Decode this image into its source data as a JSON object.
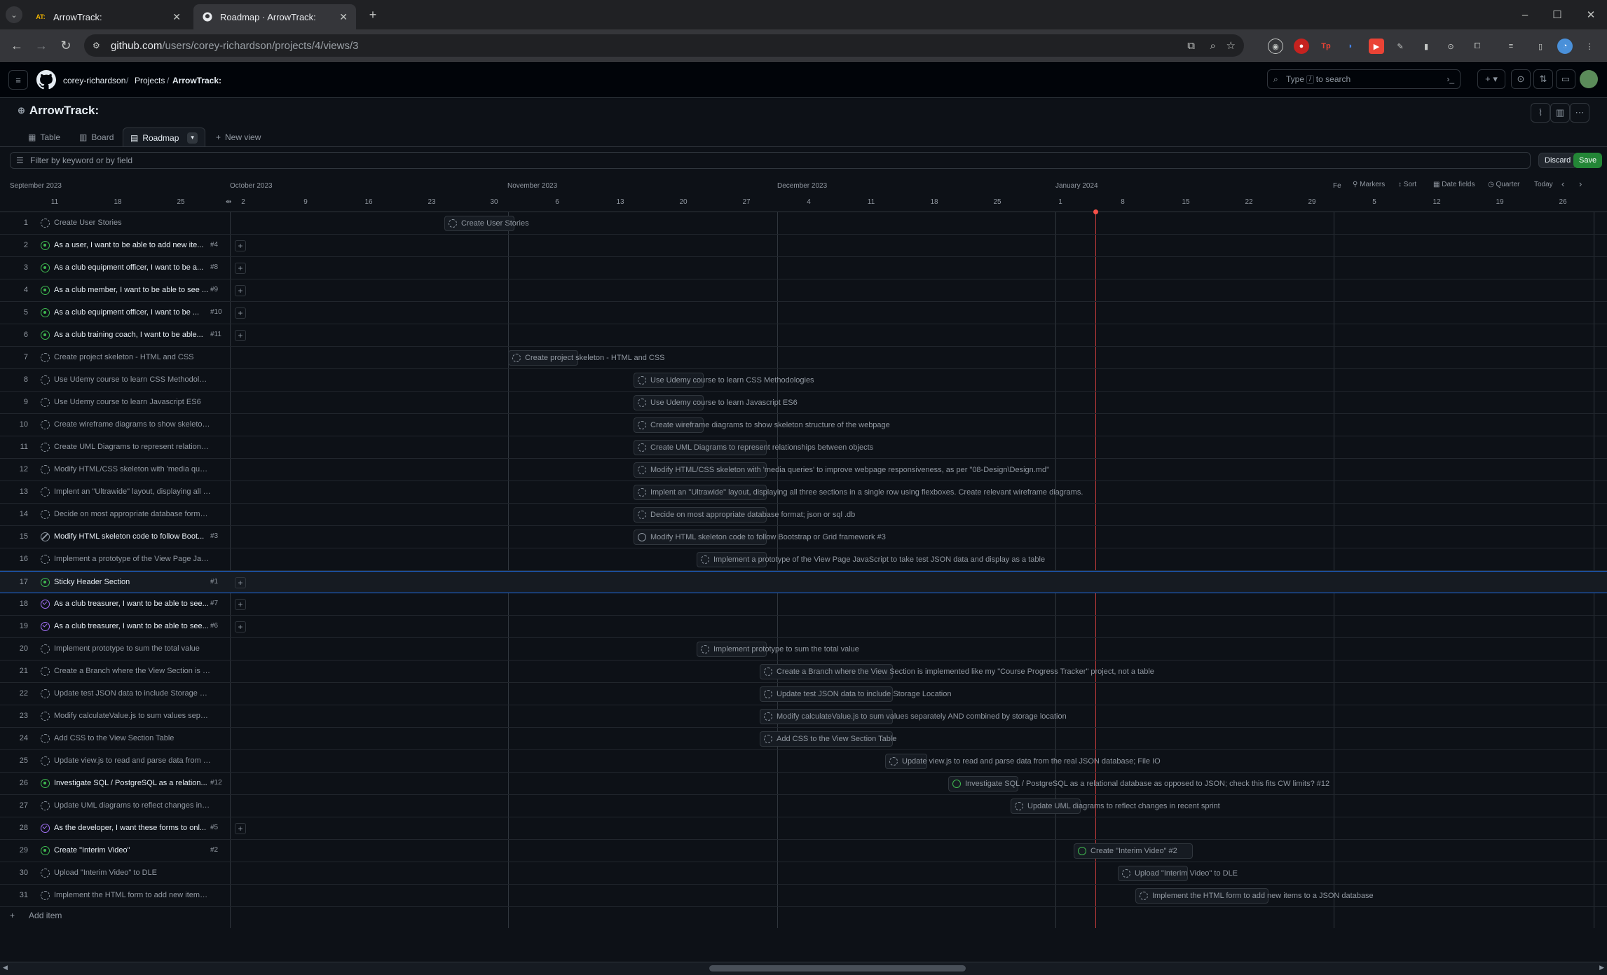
{
  "browser": {
    "tabs": [
      {
        "icon_text": "AT:",
        "title": "ArrowTrack:"
      },
      {
        "icon_text": "",
        "title": "Roadmap · ArrowTrack:"
      }
    ],
    "url_host": "github.com",
    "url_path": "/users/corey-richardson/projects/4/views/3"
  },
  "header": {
    "breadcrumb": [
      "corey-richardson",
      "/",
      "Projects",
      "/",
      "ArrowTrack:"
    ],
    "search_placeholder_prefix": "Type",
    "search_key": "/",
    "search_placeholder_suffix": "to search"
  },
  "project": {
    "title": "ArrowTrack:",
    "views": [
      "Table",
      "Board",
      "Roadmap"
    ],
    "new_view": "New view",
    "filter_placeholder": "Filter by keyword or by field",
    "discard": "Discard",
    "save": "Save"
  },
  "timeline": {
    "months": [
      "September 2023",
      "October 2023",
      "November 2023",
      "December 2023",
      "January 2024",
      "Fe"
    ],
    "days": [
      "11",
      "18",
      "25",
      "2",
      "9",
      "16",
      "23",
      "30",
      "6",
      "13",
      "20",
      "27",
      "4",
      "11",
      "18",
      "25",
      "1",
      "8",
      "15",
      "22",
      "29",
      "5",
      "12",
      "19",
      "26"
    ],
    "controls": {
      "markers": "Markers",
      "sort": "Sort",
      "date_fields": "Date fields",
      "zoom": "Quarter",
      "today": "Today"
    }
  },
  "rows": [
    {
      "n": "1",
      "title": "Create User Stories",
      "ref": "",
      "state": "draft",
      "issue": false,
      "plus": false,
      "bar": "Create User Stories"
    },
    {
      "n": "2",
      "title": "As a user, I want to be able to add new ite...",
      "ref": "#4",
      "state": "open",
      "issue": true,
      "plus": true,
      "bar": ""
    },
    {
      "n": "3",
      "title": "As a club equipment officer, I want to be a...",
      "ref": "#8",
      "state": "open",
      "issue": true,
      "plus": true,
      "bar": ""
    },
    {
      "n": "4",
      "title": "As a club member, I want to be able to see ...",
      "ref": "#9",
      "state": "open",
      "issue": true,
      "plus": true,
      "bar": ""
    },
    {
      "n": "5",
      "title": "As a club equipment officer, I want to be ...",
      "ref": "#10",
      "state": "open",
      "issue": true,
      "plus": true,
      "bar": ""
    },
    {
      "n": "6",
      "title": "As a club training coach, I want to be able...",
      "ref": "#11",
      "state": "open",
      "issue": true,
      "plus": true,
      "bar": ""
    },
    {
      "n": "7",
      "title": "Create project skeleton - HTML and CSS",
      "ref": "",
      "state": "draft",
      "issue": false,
      "plus": false,
      "bar": "Create project skeleton - HTML and CSS"
    },
    {
      "n": "8",
      "title": "Use Udemy course to learn CSS Methodologies",
      "ref": "",
      "state": "draft",
      "issue": false,
      "plus": false,
      "bar": "Use Udemy course to learn CSS Methodologies"
    },
    {
      "n": "9",
      "title": "Use Udemy course to learn Javascript ES6",
      "ref": "",
      "state": "draft",
      "issue": false,
      "plus": false,
      "bar": "Use Udemy course to learn Javascript ES6"
    },
    {
      "n": "10",
      "title": "Create wireframe diagrams to show skeleton st...",
      "ref": "",
      "state": "draft",
      "issue": false,
      "plus": false,
      "bar": "Create wireframe diagrams to show skeleton structure of the webpage"
    },
    {
      "n": "11",
      "title": "Create UML Diagrams to represent relationship...",
      "ref": "",
      "state": "draft",
      "issue": false,
      "plus": false,
      "bar": "Create UML Diagrams to represent relationships between objects"
    },
    {
      "n": "12",
      "title": "Modify HTML/CSS skeleton with 'media querie...",
      "ref": "",
      "state": "draft",
      "issue": false,
      "plus": false,
      "bar": "Modify HTML/CSS skeleton with 'media queries' to improve webpage responsiveness, as per \"08-Design\\Design.md\""
    },
    {
      "n": "13",
      "title": "Implent an \"Ultrawide\" layout, displaying all thr...",
      "ref": "",
      "state": "draft",
      "issue": false,
      "plus": false,
      "bar": "Implent an \"Ultrawide\" layout, displaying all three sections in a single row using flexboxes. Create relevant wireframe diagrams."
    },
    {
      "n": "14",
      "title": "Decide on most appropriate database format; j...",
      "ref": "",
      "state": "draft",
      "issue": false,
      "plus": false,
      "bar": "Decide on most appropriate database format; json or sql .db"
    },
    {
      "n": "15",
      "title": "Modify HTML skeleton code to follow Boot...",
      "ref": "#3",
      "state": "closed",
      "issue": true,
      "plus": false,
      "bar": "Modify HTML skeleton code to follow Bootstrap or Grid framework #3"
    },
    {
      "n": "16",
      "title": "Implement a prototype of the View Page JavaS...",
      "ref": "",
      "state": "draft",
      "issue": false,
      "plus": false,
      "bar": "Implement a prototype of the View Page JavaScript to take test JSON data and display as a table"
    },
    {
      "n": "17",
      "title": "Sticky Header Section",
      "ref": "#1",
      "state": "open",
      "issue": true,
      "plus": true,
      "bar": "",
      "sel": true
    },
    {
      "n": "18",
      "title": "As a club treasurer, I want to be able to see...",
      "ref": "#7",
      "state": "done",
      "issue": true,
      "plus": true,
      "bar": ""
    },
    {
      "n": "19",
      "title": "As a club treasurer, I want to be able to see...",
      "ref": "#6",
      "state": "done",
      "issue": true,
      "plus": true,
      "bar": ""
    },
    {
      "n": "20",
      "title": "Implement prototype to sum the total value",
      "ref": "",
      "state": "draft",
      "issue": false,
      "plus": false,
      "bar": "Implement prototype to sum the total value"
    },
    {
      "n": "21",
      "title": "Create a Branch where the View Section is impl...",
      "ref": "",
      "state": "draft",
      "issue": false,
      "plus": false,
      "bar": "Create a Branch where the View Section is implemented like my \"Course Progress Tracker\" project, not a table"
    },
    {
      "n": "22",
      "title": "Update test JSON data to include Storage Loca...",
      "ref": "",
      "state": "draft",
      "issue": false,
      "plus": false,
      "bar": "Update test JSON data to include Storage Location"
    },
    {
      "n": "23",
      "title": "Modify calculateValue.js to sum values separat...",
      "ref": "",
      "state": "draft",
      "issue": false,
      "plus": false,
      "bar": "Modify calculateValue.js to sum values separately AND combined by storage location"
    },
    {
      "n": "24",
      "title": "Add CSS to the View Section Table",
      "ref": "",
      "state": "draft",
      "issue": false,
      "plus": false,
      "bar": "Add CSS to the View Section Table"
    },
    {
      "n": "25",
      "title": "Update view.js to read and parse data from the...",
      "ref": "",
      "state": "draft",
      "issue": false,
      "plus": false,
      "bar": "Update view.js to read and parse data from the real JSON database; File IO"
    },
    {
      "n": "26",
      "title": "Investigate SQL / PostgreSQL as a relation...",
      "ref": "#12",
      "state": "open",
      "issue": true,
      "plus": false,
      "bar": "Investigate SQL / PostgreSQL as a relational database as opposed to JSON; check this fits CW limits? #12"
    },
    {
      "n": "27",
      "title": "Update UML diagrams to reflect changes in rec...",
      "ref": "",
      "state": "draft",
      "issue": false,
      "plus": false,
      "bar": "Update UML diagrams to reflect changes in recent sprint"
    },
    {
      "n": "28",
      "title": "As the developer, I want these forms to onl...",
      "ref": "#5",
      "state": "done",
      "issue": true,
      "plus": true,
      "bar": ""
    },
    {
      "n": "29",
      "title": "Create \"Interim Video\"",
      "ref": "#2",
      "state": "open",
      "issue": true,
      "plus": false,
      "bar": "Create \"Interim Video\" #2"
    },
    {
      "n": "30",
      "title": "Upload \"Interim Video\" to DLE",
      "ref": "",
      "state": "draft",
      "issue": false,
      "plus": false,
      "bar": "Upload \"Interim Video\" to DLE"
    },
    {
      "n": "31",
      "title": "Implement the HTML form to add new items to...",
      "ref": "",
      "state": "draft",
      "issue": false,
      "plus": false,
      "bar": "Implement the HTML form to add new items to a JSON database"
    }
  ],
  "add_item": "Add item"
}
